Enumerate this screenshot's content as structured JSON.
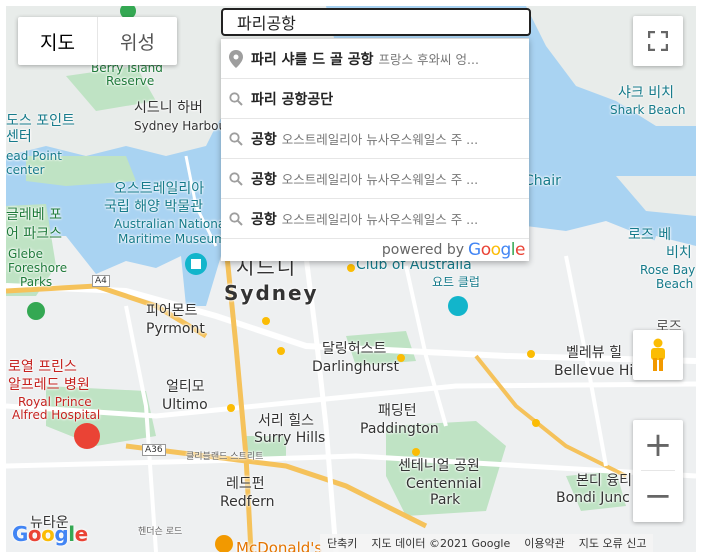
{
  "map_type": {
    "map": "지도",
    "satellite": "위성"
  },
  "search": {
    "value": "파리공항"
  },
  "autocomplete": [
    {
      "main": "파리 샤를 드 골 공항",
      "secondary": "프랑스 후와씨 엉...",
      "icon": "pin-icon"
    },
    {
      "main": "파리 공항공단",
      "secondary": "",
      "icon": "search-icon"
    },
    {
      "main": "공항",
      "secondary": "오스트레일리아 뉴사우스웨일스 주 ...",
      "icon": "search-icon"
    },
    {
      "main": "공항",
      "secondary": "오스트레일리아 뉴사우스웨일스 주 ...",
      "icon": "search-icon"
    },
    {
      "main": "공항",
      "secondary": "오스트레일리아 뉴사우스웨일스 주 ...",
      "icon": "search-icon"
    }
  ],
  "powered_by": {
    "text": "powered by",
    "brand": "Google"
  },
  "footer": {
    "shortcuts": "단축키",
    "map_data": "지도 데이터 ©2021 Google",
    "terms": "이용약관",
    "report": "지도 오류 신고"
  },
  "google_logo": "Google",
  "zoom": {
    "in": "+",
    "out": "−"
  },
  "map_labels": {
    "berry_island_ko": "베리 아일랜드",
    "berry_island_en": "Berry Island",
    "berry_island_en2": "Reserve",
    "sydney_harbour_ko": "시드니 하버",
    "sydney_harbour_en": "Sydney Harbou",
    "dawes_point_ko": "도스 포인트",
    "dawes_point_ko2": "센터",
    "dawes_point_en": "ead Point",
    "dawes_point_en2": "center",
    "maritime_ko1": "오스트레일리아",
    "maritime_ko2": "국립 해양 박물관",
    "maritime_en1": "Australian Nationa",
    "maritime_en2": "Maritime Museum",
    "glebe_ko1": "글레베 포",
    "glebe_ko2": "어 파크스",
    "glebe_en1": "Glebe",
    "glebe_en2": "Foreshore",
    "glebe_en3": "Parks",
    "sydney_ko": "시드니",
    "sydney_en": "Sydney",
    "club_en": "Club of Australia",
    "club_ko": "요트 클럽",
    "shark_ko": "샤크 비치",
    "shark_en": "Shark Beach",
    "chair_en": "Chair",
    "rose_bay_ko1": "로즈 베",
    "rose_bay_ko2": "비치",
    "rose_bay_en1": "Rose Bay",
    "rose_bay_en2": "Beach",
    "rose_ko": "로즈",
    "pyrmont_ko": "피어몬트",
    "pyrmont_en": "Pyrmont",
    "darlinghurst_ko": "달링허스트",
    "darlinghurst_en": "Darlinghurst",
    "bellevue_ko": "벨레뷰 힐",
    "bellevue_en": "Bellevue Hi",
    "rpa_ko1": "로열 프린스",
    "rpa_ko2": "알프레드 병원",
    "rpa_en1": "Royal Prince",
    "rpa_en2": "Alfred Hospital",
    "ultimo_ko": "얼티모",
    "ultimo_en": "Ultimo",
    "surry_ko": "서리 힐스",
    "surry_en": "Surry Hills",
    "paddington_ko": "패딩턴",
    "paddington_en": "Paddington",
    "centennial_ko": "센테니얼 공원",
    "centennial_en1": "Centennial",
    "centennial_en2": "Park",
    "bondi_ko": "본디 융티",
    "bondi_en": "Bondi Junc",
    "redfern_ko": "레드펀",
    "redfern_en": "Redfern",
    "newtown_ko": "뉴타운",
    "mcdonalds": "McDonald's",
    "road_a4": "A4",
    "road_a36": "A36",
    "road_cleveland": "클리블랜드 스트리트",
    "road_henderson": "헨더슨 로드"
  },
  "colors": {
    "water": "#a9d3f2",
    "park": "#bfe3c4",
    "land": "#eef0f1",
    "road": "#ffffff",
    "highway": "#f5c25b"
  }
}
